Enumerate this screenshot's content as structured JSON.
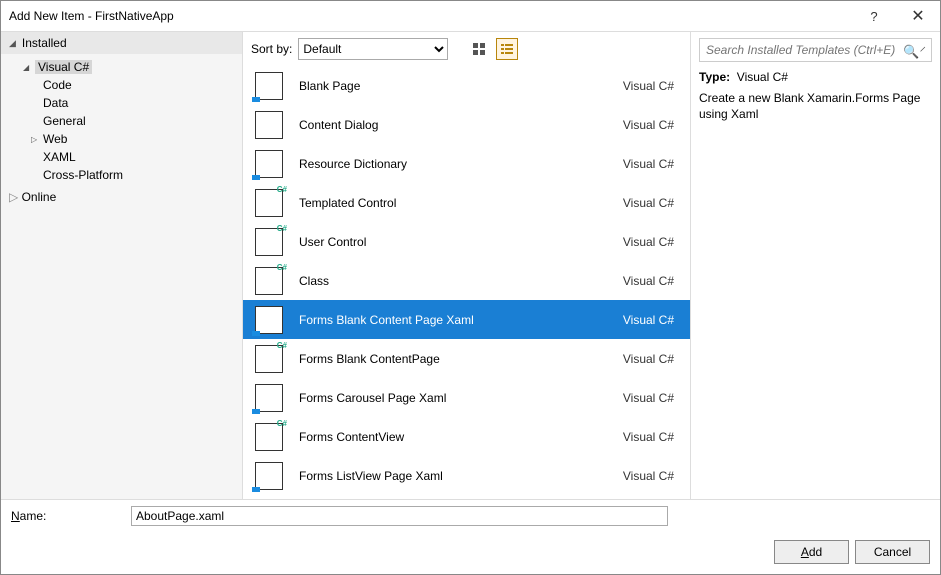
{
  "window": {
    "title": "Add New Item - FirstNativeApp"
  },
  "tree": {
    "installed_label": "Installed",
    "online_label": "Online",
    "visual_csharp_label": "Visual C#",
    "children": [
      "Code",
      "Data",
      "General",
      "Web",
      "XAML",
      "Cross-Platform"
    ]
  },
  "toolbar": {
    "sort_label": "Sort by:",
    "sort_value": "Default"
  },
  "search": {
    "placeholder": "Search Installed Templates (Ctrl+E)"
  },
  "templates": [
    {
      "label": "Blank Page",
      "lang": "Visual C#",
      "icon": "xaml"
    },
    {
      "label": "Content Dialog",
      "lang": "Visual C#",
      "icon": "dialog"
    },
    {
      "label": "Resource Dictionary",
      "lang": "Visual C#",
      "icon": "xaml"
    },
    {
      "label": "Templated Control",
      "lang": "Visual C#",
      "icon": "csharp"
    },
    {
      "label": "User Control",
      "lang": "Visual C#",
      "icon": "csharp"
    },
    {
      "label": "Class",
      "lang": "Visual C#",
      "icon": "csharp"
    },
    {
      "label": "Forms Blank Content Page Xaml",
      "lang": "Visual C#",
      "icon": "xaml",
      "selected": true
    },
    {
      "label": "Forms Blank ContentPage",
      "lang": "Visual C#",
      "icon": "csharp"
    },
    {
      "label": "Forms Carousel Page Xaml",
      "lang": "Visual C#",
      "icon": "xaml"
    },
    {
      "label": "Forms ContentView",
      "lang": "Visual C#",
      "icon": "csharp"
    },
    {
      "label": "Forms ListView Page Xaml",
      "lang": "Visual C#",
      "icon": "xaml"
    }
  ],
  "description": {
    "type_label": "Type:",
    "type_value": "Visual C#",
    "text": "Create a new Blank Xamarin.Forms Page using Xaml"
  },
  "name": {
    "label": "Name:",
    "value": "AboutPage.xaml"
  },
  "footer": {
    "add": "Add",
    "cancel": "Cancel"
  }
}
